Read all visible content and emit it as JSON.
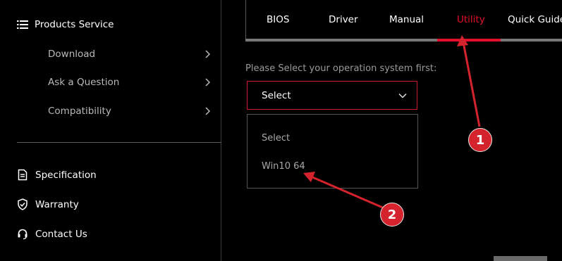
{
  "sidebar": {
    "section_title": "Products Service",
    "sub_items": [
      {
        "label": "Download"
      },
      {
        "label": "Ask a Question"
      },
      {
        "label": "Compatibility"
      }
    ],
    "bottom_items": [
      {
        "label": "Specification",
        "icon": "document-icon"
      },
      {
        "label": "Warranty",
        "icon": "shield-check-icon"
      },
      {
        "label": "Contact Us",
        "icon": "headset-icon"
      }
    ]
  },
  "tabs": [
    {
      "label": "BIOS"
    },
    {
      "label": "Driver"
    },
    {
      "label": "Manual"
    },
    {
      "label": "Utility",
      "active": true
    },
    {
      "label": "Quick Guide"
    }
  ],
  "os_select": {
    "prompt": "Please Select your operation system first:",
    "selected": "Select",
    "options": [
      "Select",
      "Win10 64"
    ]
  },
  "annotations": {
    "badge_1": "1",
    "badge_2": "2"
  },
  "colors": {
    "background": "#000000",
    "accent_red": "#e2102a",
    "annotation_red": "#d4232d",
    "muted_text": "#b9b9b9"
  }
}
